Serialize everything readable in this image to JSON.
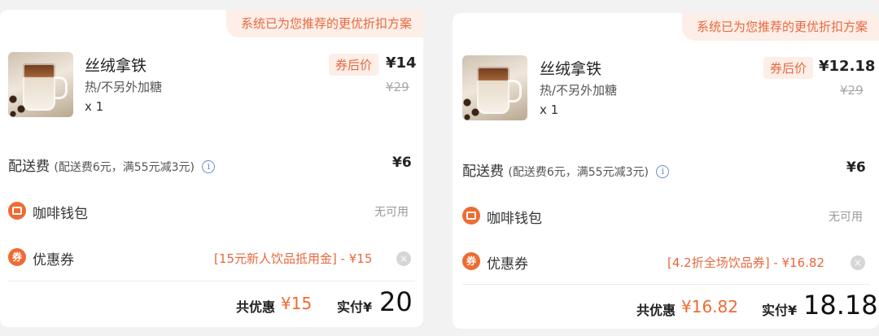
{
  "cards": [
    {
      "recommend_tag": "系统已为您推荐的更优折扣方案",
      "product": {
        "name": "丝绒拿铁",
        "spec": "热/不另外加糖",
        "quantity": "x 1",
        "after_coupon_label": "券后价",
        "final_price": "¥14",
        "original_price": "¥29"
      },
      "delivery": {
        "label": "配送费",
        "note": "(配送费6元，满55元减3元)",
        "value": "¥6"
      },
      "wallet": {
        "label": "咖啡钱包",
        "value": "无可用"
      },
      "coupon": {
        "label": "优惠券",
        "value": "[15元新人饮品抵用金] - ¥15"
      },
      "total": {
        "discount_label": "共优惠",
        "discount_value": "¥15",
        "paid_label": "实付¥",
        "paid_value": "20"
      }
    },
    {
      "recommend_tag": "系统已为您推荐的更优折扣方案",
      "product": {
        "name": "丝绒拿铁",
        "spec": "热/不另外加糖",
        "quantity": "x 1",
        "after_coupon_label": "券后价",
        "final_price": "¥12.18",
        "original_price": "¥29"
      },
      "delivery": {
        "label": "配送费",
        "note": "(配送费6元，满55元减3元)",
        "value": "¥6"
      },
      "wallet": {
        "label": "咖啡钱包",
        "value": "无可用"
      },
      "coupon": {
        "label": "优惠券",
        "value": "[4.2折全场饮品券] - ¥16.82"
      },
      "total": {
        "discount_label": "共优惠",
        "discount_value": "¥16.82",
        "paid_label": "实付¥",
        "paid_value": "18.18"
      }
    }
  ],
  "icons": {
    "info": "info-icon",
    "wallet": "wallet-icon",
    "coupon": "coupon-icon",
    "clear": "clear-icon"
  },
  "colors": {
    "accent": "#ef6b32",
    "accent_bg": "#fdeee8"
  }
}
